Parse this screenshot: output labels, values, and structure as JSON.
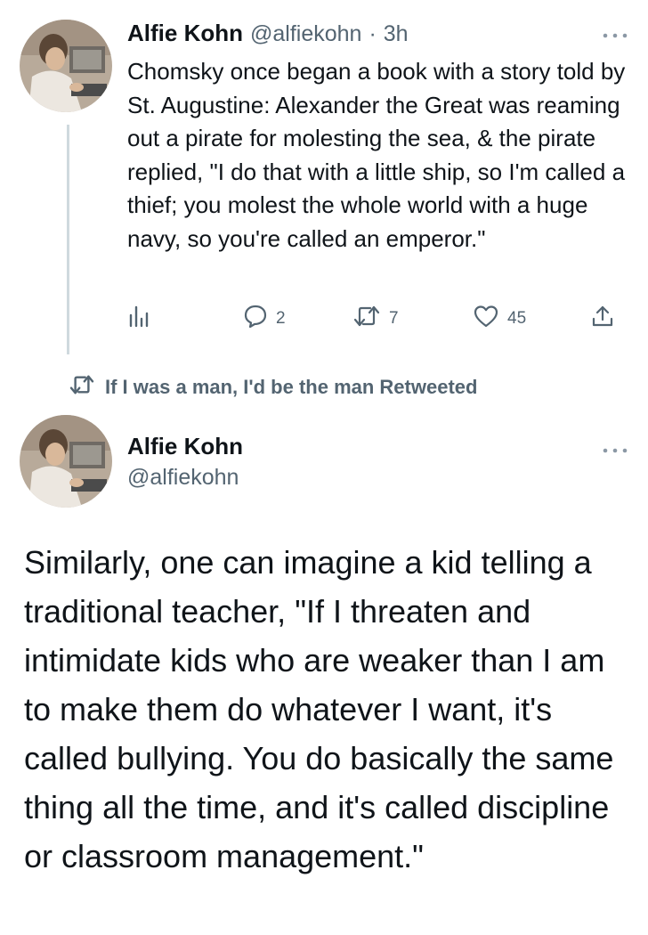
{
  "tweet1": {
    "name": "Alfie Kohn",
    "handle": "@alfiekohn",
    "separator": "·",
    "time": "3h",
    "more_icon": "ellipsis-icon",
    "text": "Chomsky once began a book with a story told by St. Augustine: Alexander the Great was reaming out a pirate for molesting the sea, & the pirate replied, \"I do that with a little ship, so I'm called a thief; you molest the whole world with a huge navy, so you're called an emperor.\"",
    "actions": {
      "analytics_icon": "analytics-icon",
      "replies": "2",
      "retweets": "7",
      "likes": "45",
      "share_icon": "share-icon"
    }
  },
  "retweet_notice": {
    "text": "If I was a man, I'd be the man Retweeted",
    "icon": "retweet-icon"
  },
  "tweet2": {
    "name": "Alfie Kohn",
    "handle": "@alfiekohn",
    "more_icon": "ellipsis-icon",
    "text": "Similarly, one can imagine a kid telling a traditional teacher, \"If I threaten and intimidate kids who are weaker than I am to make them do whatever I want, it's called bullying. You do basically the same thing all the time, and it's called discipline or classroom management.\""
  },
  "colors": {
    "text": "#0f1419",
    "secondary": "#536471",
    "thread_line": "#cfd9de",
    "background": "#ffffff"
  }
}
